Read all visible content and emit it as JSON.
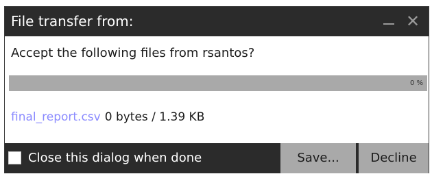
{
  "window": {
    "title": "File transfer from:",
    "minimize_icon": "minimize-icon",
    "close_icon": "close-icon",
    "close_glyph": "✕"
  },
  "prompt": {
    "text": "Accept the following files from rsantos?"
  },
  "progress": {
    "percent_label": "0 %",
    "value": 0
  },
  "file": {
    "name": "final_report.csv",
    "size": "0 bytes / 1.39 KB"
  },
  "footer": {
    "checkbox_label": "Close this dialog when done",
    "checked": false,
    "save_label": "Save...",
    "decline_label": "Decline"
  },
  "colors": {
    "titlebar": "#2b2b2b",
    "progress_track": "#a9a9a9",
    "link": "#8b8bff",
    "button": "#a9a9a9"
  }
}
